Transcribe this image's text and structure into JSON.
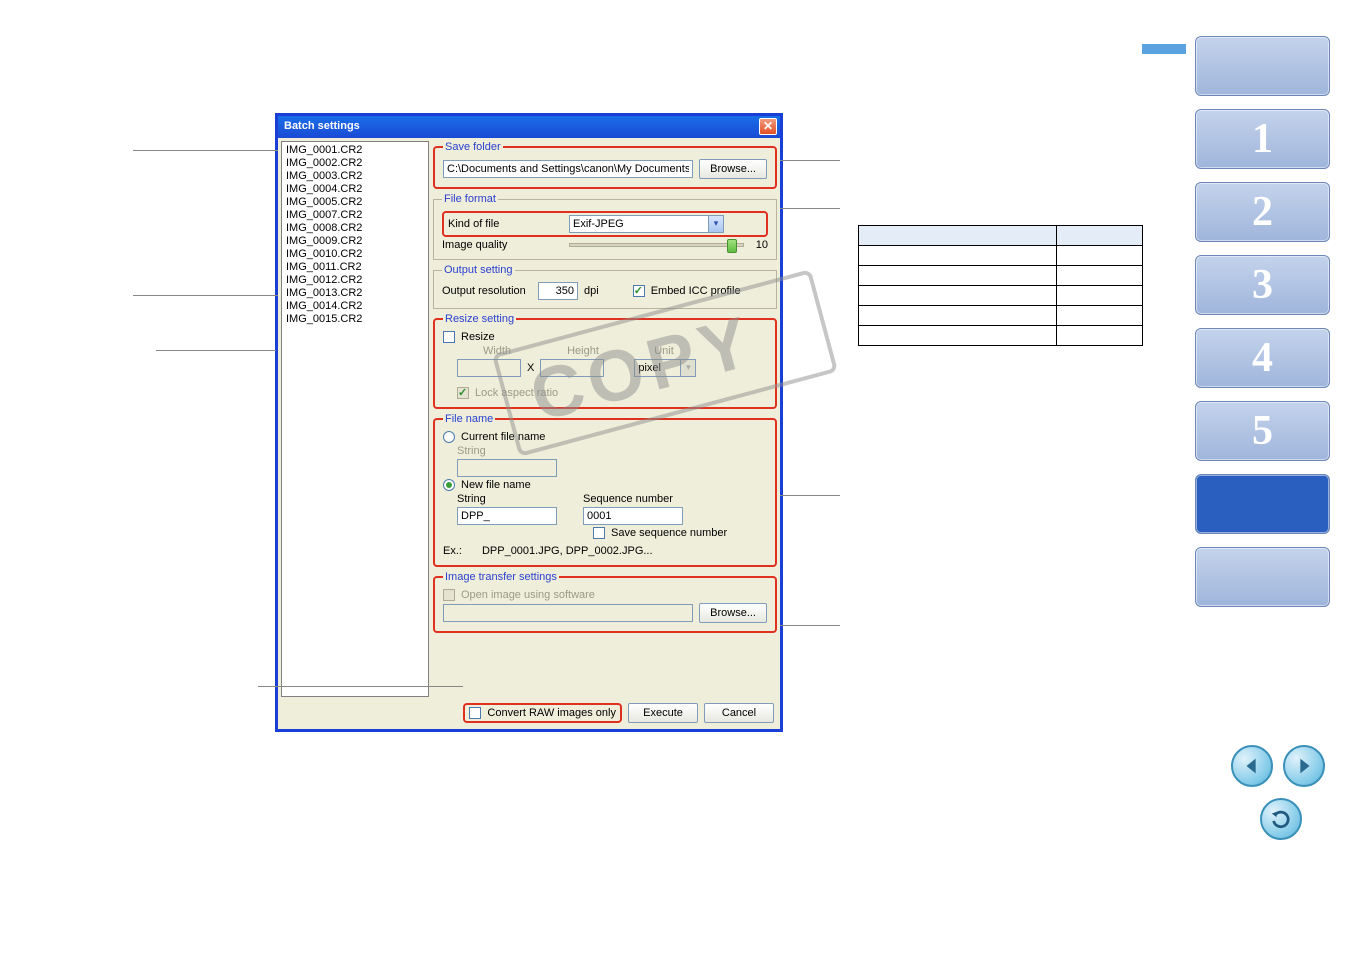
{
  "dialog": {
    "title": "Batch settings",
    "files": [
      "IMG_0001.CR2",
      "IMG_0002.CR2",
      "IMG_0003.CR2",
      "IMG_0004.CR2",
      "IMG_0005.CR2",
      "IMG_0007.CR2",
      "IMG_0008.CR2",
      "IMG_0009.CR2",
      "IMG_0010.CR2",
      "IMG_0011.CR2",
      "IMG_0012.CR2",
      "IMG_0013.CR2",
      "IMG_0014.CR2",
      "IMG_0015.CR2"
    ],
    "saveFolder": {
      "legend": "Save folder",
      "path": "C:\\Documents and Settings\\canon\\My Documents\\",
      "browse": "Browse..."
    },
    "fileFormat": {
      "legend": "File format",
      "kindLabel": "Kind of file",
      "kindValue": "Exif-JPEG",
      "qualityLabel": "Image quality",
      "qualityValue": "10"
    },
    "output": {
      "legend": "Output setting",
      "resLabel": "Output resolution",
      "resValue": "350",
      "resUnit": "dpi",
      "iccLabel": "Embed ICC profile"
    },
    "resize": {
      "legend": "Resize setting",
      "resizeLabel": "Resize",
      "widthLabel": "Width",
      "heightLabel": "Height",
      "unitLabel": "Unit",
      "x": "X",
      "unitValue": "pixel",
      "lockLabel": "Lock aspect ratio"
    },
    "fileName": {
      "legend": "File name",
      "currentLabel": "Current file name",
      "stringLabel": "String",
      "newLabel": "New file name",
      "seqLabel": "Sequence number",
      "stringValue": "DPP_",
      "seqValue": "0001",
      "saveSeqLabel": "Save sequence number",
      "exLabel": "Ex.:",
      "exValue": "DPP_0001.JPG, DPP_0002.JPG..."
    },
    "transfer": {
      "legend": "Image transfer settings",
      "openLabel": "Open image using software",
      "browse": "Browse..."
    },
    "footer": {
      "convertRawOnly": "Convert RAW images only",
      "execute": "Execute",
      "cancel": "Cancel"
    }
  },
  "nav": {
    "items": [
      "",
      "1",
      "2",
      "3",
      "4",
      "5",
      "",
      ""
    ]
  },
  "watermark": "COPY"
}
